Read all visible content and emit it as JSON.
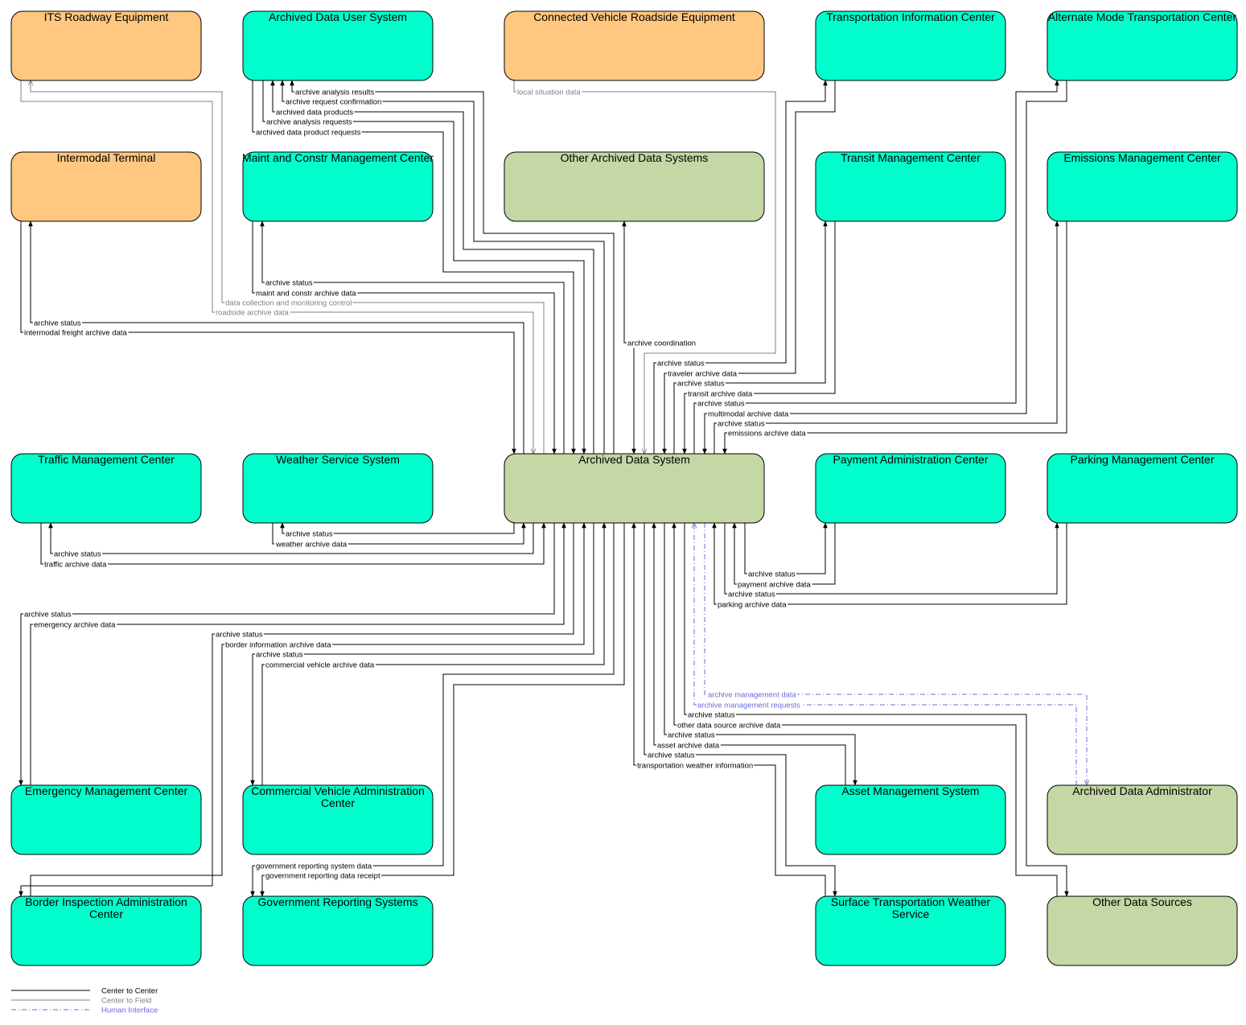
{
  "colors": {
    "field": "#FFC77F",
    "center": "#00FFCC",
    "system": "#C4D7A4",
    "line_center": "#000000",
    "line_field": "#808080",
    "line_human": "#6A6AE0",
    "border": "#000000"
  },
  "nodes": [
    {
      "id": "its",
      "label": [
        "ITS Roadway Equipment"
      ],
      "kind": "field"
    },
    {
      "id": "adus",
      "label": [
        "Archived Data User System"
      ],
      "kind": "center"
    },
    {
      "id": "cvre",
      "label": [
        "Connected Vehicle Roadside Equipment"
      ],
      "kind": "field"
    },
    {
      "id": "tic",
      "label": [
        "Transportation Information Center"
      ],
      "kind": "center"
    },
    {
      "id": "amtc",
      "label": [
        "Alternate Mode Transportation Center"
      ],
      "kind": "center"
    },
    {
      "id": "it",
      "label": [
        "Intermodal Terminal"
      ],
      "kind": "field"
    },
    {
      "id": "mcmc",
      "label": [
        "Maint and Constr Management Center"
      ],
      "kind": "center"
    },
    {
      "id": "oads",
      "label": [
        "Other Archived Data Systems"
      ],
      "kind": "system"
    },
    {
      "id": "tmc2",
      "label": [
        "Transit Management Center"
      ],
      "kind": "center"
    },
    {
      "id": "emc",
      "label": [
        "Emissions Management Center"
      ],
      "kind": "center"
    },
    {
      "id": "tmc",
      "label": [
        "Traffic Management Center"
      ],
      "kind": "center"
    },
    {
      "id": "wss",
      "label": [
        "Weather Service System"
      ],
      "kind": "center"
    },
    {
      "id": "ads",
      "label": [
        "Archived Data System"
      ],
      "kind": "system"
    },
    {
      "id": "pac",
      "label": [
        "Payment Administration Center"
      ],
      "kind": "center"
    },
    {
      "id": "pmc",
      "label": [
        "Parking Management Center"
      ],
      "kind": "center"
    },
    {
      "id": "emgc",
      "label": [
        "Emergency Management Center"
      ],
      "kind": "center"
    },
    {
      "id": "cvac",
      "label": [
        "Commercial Vehicle Administration",
        "Center"
      ],
      "kind": "center"
    },
    {
      "id": "ams",
      "label": [
        "Asset Management System"
      ],
      "kind": "center"
    },
    {
      "id": "ada",
      "label": [
        "Archived Data Administrator"
      ],
      "kind": "system"
    },
    {
      "id": "biac",
      "label": [
        "Border Inspection Administration",
        "Center"
      ],
      "kind": "center"
    },
    {
      "id": "grs",
      "label": [
        "Government Reporting Systems"
      ],
      "kind": "center"
    },
    {
      "id": "stws",
      "label": [
        "Surface Transportation Weather",
        "Service"
      ],
      "kind": "center"
    },
    {
      "id": "ods",
      "label": [
        "Other Data Sources"
      ],
      "kind": "system"
    }
  ],
  "flows": [
    {
      "label": "archive analysis results",
      "type": "c2c"
    },
    {
      "label": "archive request confirmation",
      "type": "c2c"
    },
    {
      "label": "archived data products",
      "type": "c2c"
    },
    {
      "label": "archive analysis requests",
      "type": "c2c"
    },
    {
      "label": "archived data product requests",
      "type": "c2c"
    },
    {
      "label": "local situation data",
      "type": "c2f"
    },
    {
      "label": "archive status",
      "type": "c2c"
    },
    {
      "label": "maint and constr archive data",
      "type": "c2c"
    },
    {
      "label": "data collection and monitoring control",
      "type": "c2f"
    },
    {
      "label": "roadside archive data",
      "type": "c2f"
    },
    {
      "label": "archive status",
      "type": "c2c"
    },
    {
      "label": "intermodal freight archive data",
      "type": "c2c"
    },
    {
      "label": "archive coordination",
      "type": "c2c"
    },
    {
      "label": "archive status",
      "type": "c2c"
    },
    {
      "label": "traveler archive data",
      "type": "c2c"
    },
    {
      "label": "archive status",
      "type": "c2c"
    },
    {
      "label": "transit archive data",
      "type": "c2c"
    },
    {
      "label": "archive status",
      "type": "c2c"
    },
    {
      "label": "multimodal archive data",
      "type": "c2c"
    },
    {
      "label": "archive status",
      "type": "c2c"
    },
    {
      "label": "emissions archive data",
      "type": "c2c"
    },
    {
      "label": "archive status",
      "type": "c2c"
    },
    {
      "label": "weather archive data",
      "type": "c2c"
    },
    {
      "label": "archive status",
      "type": "c2c"
    },
    {
      "label": "traffic archive data",
      "type": "c2c"
    },
    {
      "label": "archive status",
      "type": "c2c"
    },
    {
      "label": "payment archive data",
      "type": "c2c"
    },
    {
      "label": "archive status",
      "type": "c2c"
    },
    {
      "label": "parking archive data",
      "type": "c2c"
    },
    {
      "label": "archive status",
      "type": "c2c"
    },
    {
      "label": "emergency archive data",
      "type": "c2c"
    },
    {
      "label": "archive status",
      "type": "c2c"
    },
    {
      "label": "border information archive data",
      "type": "c2c"
    },
    {
      "label": "archive status",
      "type": "c2c"
    },
    {
      "label": "commercial vehicle archive data",
      "type": "c2c"
    },
    {
      "label": "archive management data",
      "type": "hi"
    },
    {
      "label": "archive management requests",
      "type": "hi"
    },
    {
      "label": "archive status",
      "type": "c2c"
    },
    {
      "label": "other data source archive data",
      "type": "c2c"
    },
    {
      "label": "archive status",
      "type": "c2c"
    },
    {
      "label": "asset archive data",
      "type": "c2c"
    },
    {
      "label": "archive status",
      "type": "c2c"
    },
    {
      "label": "transportation weather information",
      "type": "c2c"
    },
    {
      "label": "government reporting system data",
      "type": "c2c"
    },
    {
      "label": "government reporting data receipt",
      "type": "c2c"
    }
  ],
  "legend": [
    {
      "label": "Center to Center",
      "type": "c2c"
    },
    {
      "label": "Center to Field",
      "type": "c2f"
    },
    {
      "label": "Human Interface",
      "type": "hi"
    }
  ]
}
